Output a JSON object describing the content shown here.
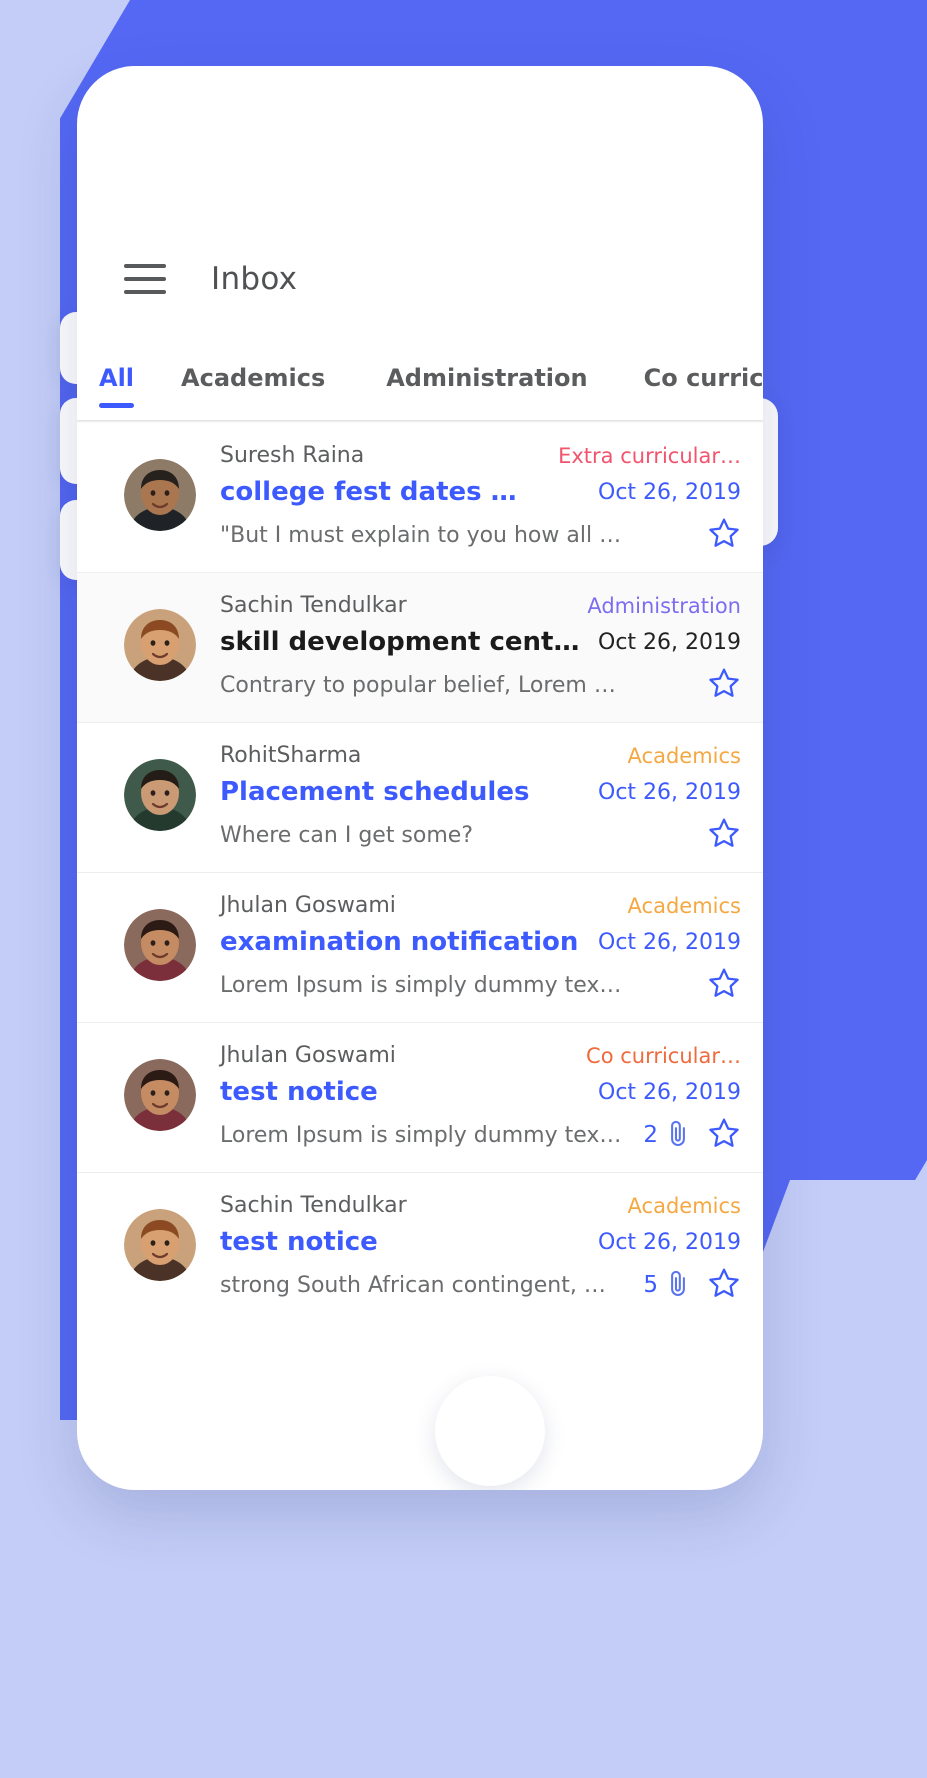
{
  "theme": {
    "bg_light": "#c3cdf7",
    "bg_accent": "#5468f4",
    "primary": "#3d5afe",
    "card": "#ffffff"
  },
  "appbar": {
    "menu_icon": "hamburger-menu-icon",
    "title": "Inbox"
  },
  "tabs": [
    {
      "label": "All",
      "active": true
    },
    {
      "label": "Academics",
      "active": false
    },
    {
      "label": "Administration",
      "active": false
    },
    {
      "label": "Co curricular",
      "active": false
    }
  ],
  "emails": [
    {
      "sender": "Suresh Raina",
      "category": "Extra curricular…",
      "category_color": "#f2536d",
      "subject": "college fest dates …",
      "subject_color": "#3d5afe",
      "date": "Oct 26, 2019",
      "date_color": "#3d5afe",
      "preview": "\"But I must explain to you how all …",
      "attachments": "",
      "starred": false,
      "alt": false
    },
    {
      "sender": "Sachin Tendulkar",
      "category": "Administration",
      "category_color": "#7b6ef0",
      "subject": "skill development cent…",
      "subject_color": "#1b1b1b",
      "date": "Oct 26, 2019",
      "date_color": "#222222",
      "preview": "Contrary to popular belief, Lorem …",
      "attachments": "",
      "starred": false,
      "alt": true
    },
    {
      "sender": "RohitSharma",
      "category": "Academics",
      "category_color": "#f5a841",
      "subject": "Placement schedules",
      "subject_color": "#3d5afe",
      "date": "Oct 26, 2019",
      "date_color": "#3d5afe",
      "preview": "Where can I get some?",
      "attachments": "",
      "starred": false,
      "alt": false
    },
    {
      "sender": "Jhulan Goswami",
      "category": "Academics",
      "category_color": "#f5a841",
      "subject": "examination notification",
      "subject_color": "#3d5afe",
      "date": "Oct 26, 2019",
      "date_color": "#3d5afe",
      "preview": "Lorem Ipsum is simply dummy tex…",
      "attachments": "",
      "starred": false,
      "alt": false
    },
    {
      "sender": "Jhulan Goswami",
      "category": "Co curricular…",
      "category_color": "#ef6a3c",
      "subject": "test notice",
      "subject_color": "#3d5afe",
      "date": "Oct 26, 2019",
      "date_color": "#3d5afe",
      "preview": "Lorem Ipsum is simply dummy tex…",
      "attachments": "2",
      "starred": false,
      "alt": false
    },
    {
      "sender": "Sachin Tendulkar",
      "category": "Academics",
      "category_color": "#f5a841",
      "subject": "test notice",
      "subject_color": "#3d5afe",
      "date": "Oct 26, 2019",
      "date_color": "#3d5afe",
      "preview": "strong South African contingent, …",
      "attachments": "5",
      "starred": false,
      "alt": false
    }
  ],
  "icons": {
    "star": "star-outline-icon",
    "attachment": "paperclip-icon",
    "home": "home-indicator"
  }
}
